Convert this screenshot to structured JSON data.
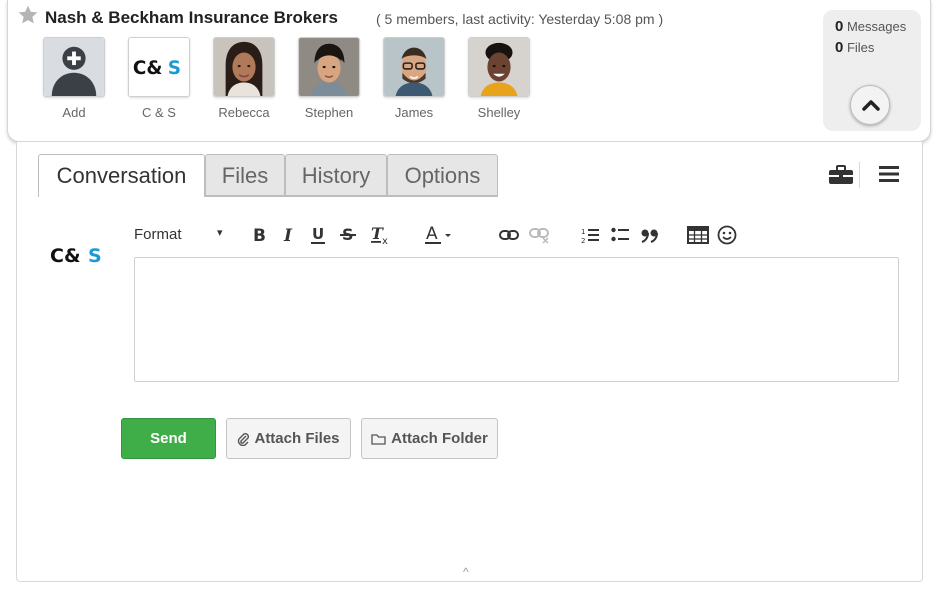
{
  "header": {
    "title": "Nash & Beckham Insurance Brokers",
    "meta": "( 5 members, last activity: Yesterday 5:08 pm )",
    "favorite_icon": "star-icon"
  },
  "members": [
    {
      "name": "Add",
      "kind": "add"
    },
    {
      "name": "C & S",
      "kind": "logo"
    },
    {
      "name": "Rebecca",
      "kind": "photo"
    },
    {
      "name": "Stephen",
      "kind": "photo"
    },
    {
      "name": "James",
      "kind": "photo"
    },
    {
      "name": "Shelley",
      "kind": "photo"
    }
  ],
  "stats": {
    "messages_count": "0",
    "messages_label": "Messages",
    "files_count": "0",
    "files_label": "Files"
  },
  "tabs": [
    {
      "label": "Conversation",
      "active": true
    },
    {
      "label": "Files",
      "active": false
    },
    {
      "label": "History",
      "active": false
    },
    {
      "label": "Options",
      "active": false
    }
  ],
  "editor": {
    "format_label": "Format",
    "format_caret": "▾",
    "buttons": [
      "bold",
      "italic",
      "underline",
      "strikethrough",
      "clear-format",
      "text-color",
      "link",
      "unlink",
      "numbered-list",
      "bulleted-list",
      "blockquote",
      "table",
      "emoji"
    ],
    "value": ""
  },
  "logo_text": "C&S",
  "actions": {
    "send": "Send",
    "attach_files": "Attach Files",
    "attach_folder": "Attach Folder"
  },
  "bottom_caret": "^",
  "colors": {
    "send_green": "#3fae49",
    "logo_blue": "#1a9bd7",
    "tab_inactive": "#e6e6e6"
  }
}
